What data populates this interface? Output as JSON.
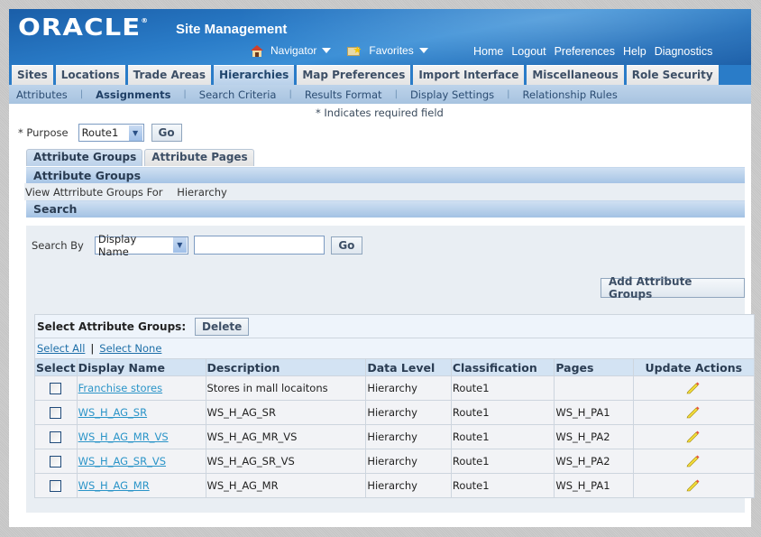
{
  "header": {
    "logo": "ORACLE",
    "app_title": "Site Management",
    "navigator_label": "Navigator",
    "favorites_label": "Favorites",
    "global_links": [
      "Home",
      "Logout",
      "Preferences",
      "Help",
      "Diagnostics"
    ]
  },
  "tabs": [
    {
      "label": "Sites",
      "active": false
    },
    {
      "label": "Locations",
      "active": false
    },
    {
      "label": "Trade Areas",
      "active": false
    },
    {
      "label": "Hierarchies",
      "active": true
    },
    {
      "label": "Map Preferences",
      "active": false
    },
    {
      "label": "Import Interface",
      "active": false
    },
    {
      "label": "Miscellaneous",
      "active": false
    },
    {
      "label": "Role Security",
      "active": false
    }
  ],
  "subtabs": [
    {
      "label": "Attributes",
      "active": false
    },
    {
      "label": "Assignments",
      "active": true
    },
    {
      "label": "Search Criteria",
      "active": false
    },
    {
      "label": "Results Format",
      "active": false
    },
    {
      "label": "Display Settings",
      "active": false
    },
    {
      "label": "Relationship Rules",
      "active": false
    }
  ],
  "required_note": "* Indicates required field",
  "purpose": {
    "label": "* Purpose",
    "value": "Route1",
    "go_label": "Go"
  },
  "inner_tabs": [
    {
      "label": "Attribute Groups",
      "active": true
    },
    {
      "label": "Attribute Pages",
      "active": false
    }
  ],
  "attribute_groups_section": {
    "title": "Attribute Groups",
    "view_label": "View Attrribute Groups For",
    "view_value": "Hierarchy"
  },
  "search": {
    "title": "Search",
    "search_by_label": "Search By",
    "search_by_value": "Display Name",
    "input_value": "",
    "go_label": "Go",
    "add_button_label": "Add Attribute Groups"
  },
  "table": {
    "select_label": "Select Attribute Groups:",
    "delete_label": "Delete",
    "select_all": "Select All",
    "select_none": "Select None",
    "columns": [
      "Select",
      "Display Name",
      "Description",
      "Data Level",
      "Classification",
      "Pages",
      "Update Actions"
    ],
    "rows": [
      {
        "display_name": "Franchise stores",
        "description": "Stores in mall locaitons",
        "data_level": "Hierarchy",
        "classification": "Route1",
        "pages": "",
        "checked": false
      },
      {
        "display_name": "WS_H_AG_SR",
        "description": "WS_H_AG_SR",
        "data_level": "Hierarchy",
        "classification": "Route1",
        "pages": "WS_H_PA1",
        "checked": false
      },
      {
        "display_name": "WS_H_AG_MR_VS",
        "description": "WS_H_AG_MR_VS",
        "data_level": "Hierarchy",
        "classification": "Route1",
        "pages": "WS_H_PA2",
        "checked": false
      },
      {
        "display_name": "WS_H_AG_SR_VS",
        "description": "WS_H_AG_SR_VS",
        "data_level": "Hierarchy",
        "classification": "Route1",
        "pages": "WS_H_PA2",
        "checked": false
      },
      {
        "display_name": "WS_H_AG_MR",
        "description": "WS_H_AG_MR",
        "data_level": "Hierarchy",
        "classification": "Route1",
        "pages": "WS_H_PA1",
        "checked": false
      }
    ]
  }
}
